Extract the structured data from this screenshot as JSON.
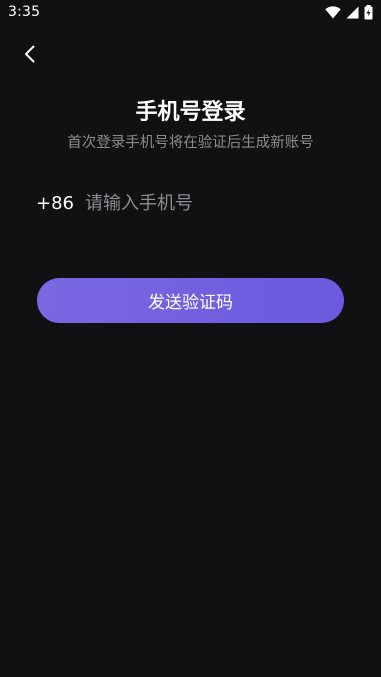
{
  "status_bar": {
    "time": "3:35",
    "icons": [
      "wifi-icon",
      "signal-icon",
      "battery-icon"
    ]
  },
  "header": {
    "back_icon": "chevron-left-icon"
  },
  "login": {
    "title": "手机号登录",
    "subtitle": "首次登录手机号将在验证后生成新账号",
    "country_code": "+86",
    "phone_placeholder": "请输入手机号",
    "phone_value": "",
    "send_button_label": "发送验证码"
  },
  "colors": {
    "background": "#111113",
    "accent": "#7264e0",
    "subtle_text": "#8a8a90"
  }
}
